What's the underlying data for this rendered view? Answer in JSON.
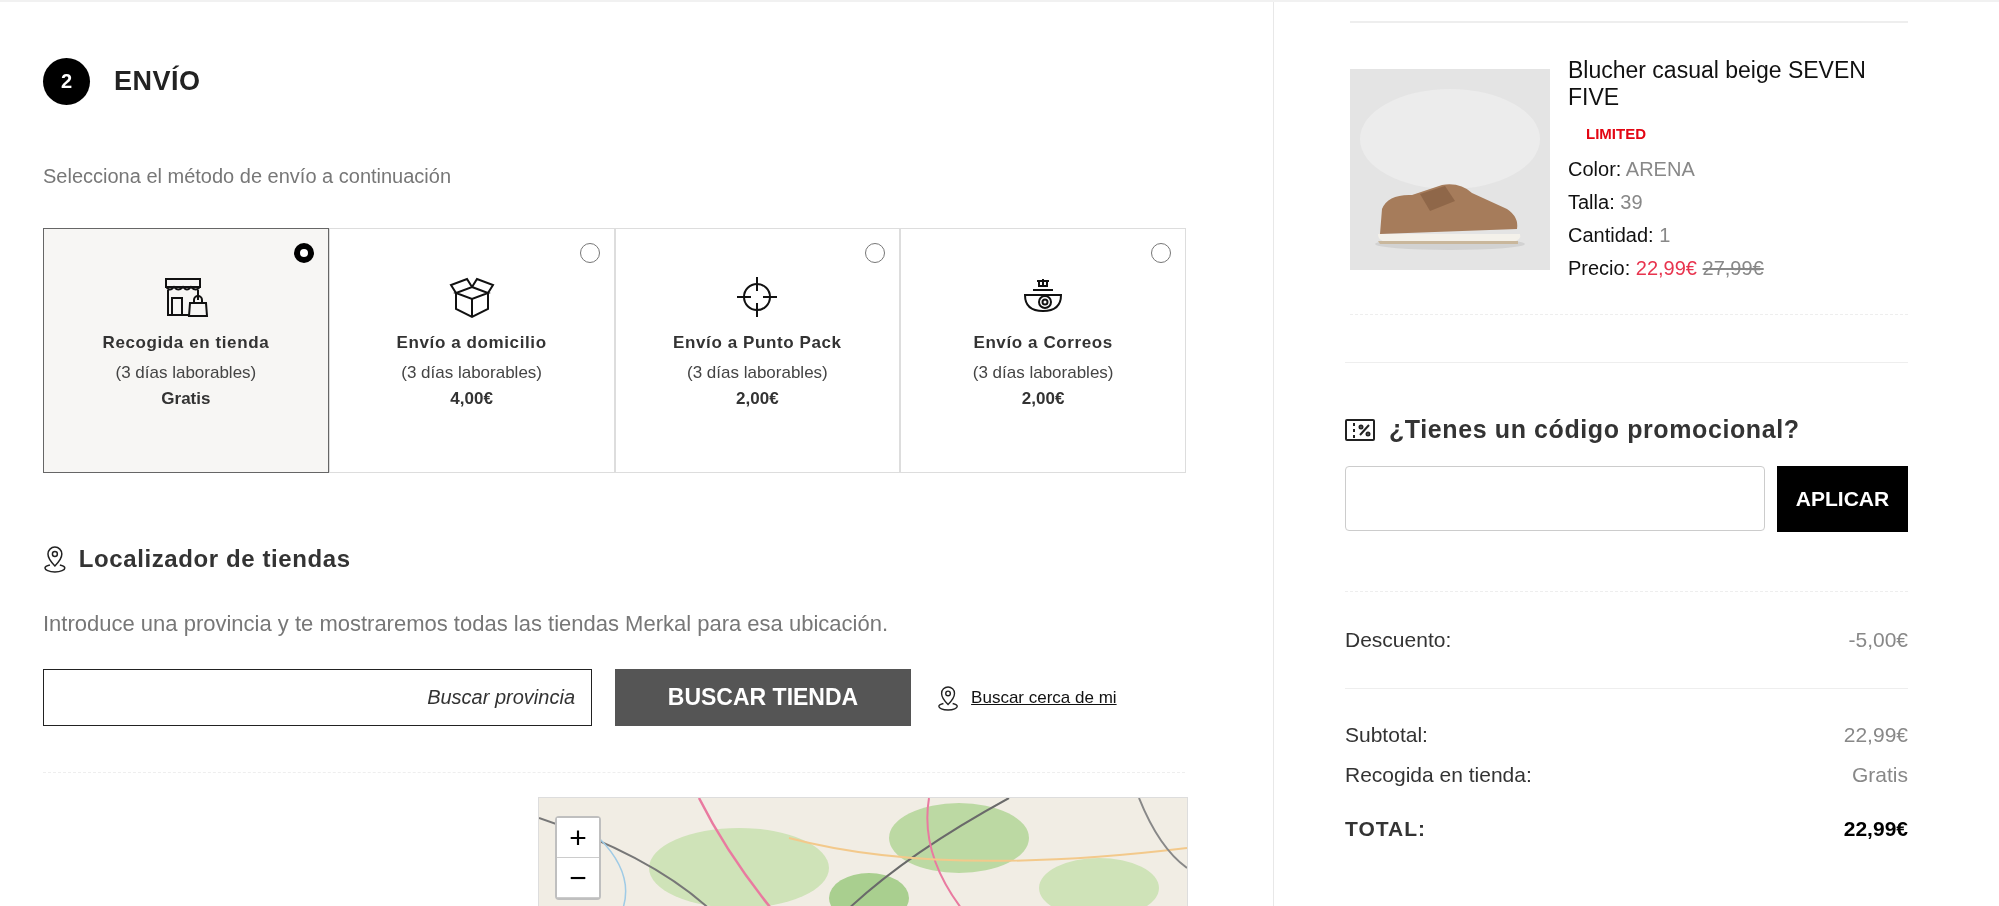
{
  "step": {
    "number": "2",
    "title": "ENVÍO"
  },
  "shipping": {
    "intro": "Selecciona el método de envío a continuación",
    "options": [
      {
        "name": "Recogida en tienda",
        "days": "(3 días laborables)",
        "price": "Gratis",
        "selected": true
      },
      {
        "name": "Envío a domicilio",
        "days": "(3 días laborables)",
        "price": "4,00€",
        "selected": false
      },
      {
        "name": "Envío a Punto Pack",
        "days": "(3 días laborables)",
        "price": "2,00€",
        "selected": false
      },
      {
        "name": "Envío a Correos",
        "days": "(3 días laborables)",
        "price": "2,00€",
        "selected": false
      }
    ]
  },
  "store_locator": {
    "title": "Localizador de tiendas",
    "description": "Introduce una provincia y te mostraremos todas las tiendas Merkal para esa ubicación.",
    "search": {
      "placeholder": "Buscar provincia"
    },
    "button": "BUSCAR TIENDA",
    "near_me": "Buscar cerca de mi",
    "map": {
      "kind": "picture",
      "zoom_in": "+",
      "zoom_out": "−"
    }
  },
  "product": {
    "title": "Blucher casual beige SEVEN FIVE",
    "badge": "LIMITED",
    "attributes": [
      {
        "label": "Color:",
        "value": "ARENA"
      },
      {
        "label": "Talla:",
        "value": "39"
      },
      {
        "label": "Cantidad:",
        "value": "1"
      }
    ],
    "price_label": "Precio:",
    "price": "22,99€",
    "old_price": "27,99€"
  },
  "promo": {
    "title": "¿Tienes un código promocional?",
    "button": "APLICAR"
  },
  "discount": {
    "label": "Descuento:",
    "value": "-5,00€"
  },
  "totals": [
    {
      "label": "Subtotal:",
      "value": "22,99€"
    },
    {
      "label": "Recogida en tienda:",
      "value": "Gratis"
    }
  ],
  "total": {
    "label": "TOTAL:",
    "value": "22,99€"
  }
}
